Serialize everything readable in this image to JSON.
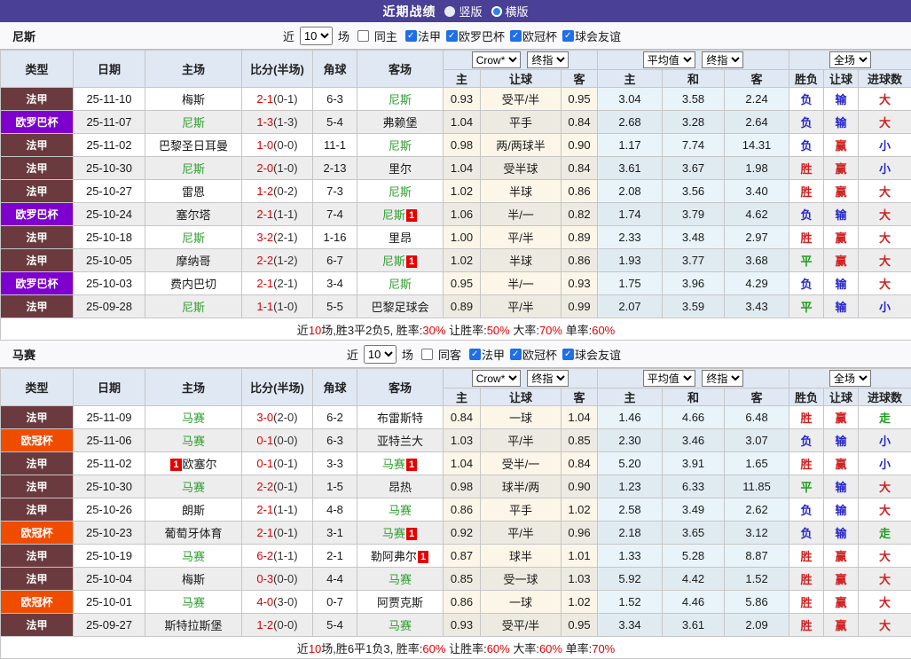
{
  "topbar": {
    "title": "近期战绩",
    "radios": [
      {
        "label": "竖版",
        "selected": false
      },
      {
        "label": "横版",
        "selected": true
      }
    ]
  },
  "columns": {
    "main": [
      "类型",
      "日期",
      "主场",
      "比分(半场)",
      "角球",
      "客场"
    ],
    "sub": [
      "主",
      "让球",
      "客",
      "主",
      "和",
      "客",
      "胜负",
      "让球",
      "进球数"
    ]
  },
  "league_colors": {
    "法甲": "#6b3a3e",
    "欧罗巴杯": "#7e00cf",
    "欧冠杯": "#f04c00"
  },
  "result_colors": {
    "胜": "#d02020",
    "平": "#1f9b1f",
    "负": "#2626cc",
    "赢": "#d02020",
    "输": "#2626cc",
    "大": "#d02020",
    "小": "#2626cc",
    "走": "#1f9b1f"
  },
  "sections": [
    {
      "team": "尼斯",
      "filters": {
        "near": "近",
        "count": "10",
        "unit": "场",
        "same": {
          "label": "同主",
          "checked": false
        },
        "leagues": [
          {
            "label": "法甲",
            "checked": true
          },
          {
            "label": "欧罗巴杯",
            "checked": true
          },
          {
            "label": "欧冠杯",
            "checked": true
          },
          {
            "label": "球会友谊",
            "checked": true
          }
        ]
      },
      "selects": [
        "Crow*",
        "终指",
        "平均值",
        "终指",
        "全场"
      ],
      "rows": [
        {
          "league": "法甲",
          "date": "25-11-10",
          "home": {
            "name": "梅斯"
          },
          "score": {
            "ft": "2-1",
            "ht": "(0-1)"
          },
          "corners": "6-3",
          "away": {
            "name": "尼斯",
            "self": true
          },
          "odds": [
            "0.93",
            "受平/半",
            "0.95"
          ],
          "avg": [
            "3.04",
            "3.58",
            "2.24"
          ],
          "results": [
            "负",
            "输",
            "大"
          ]
        },
        {
          "league": "欧罗巴杯",
          "date": "25-11-07",
          "home": {
            "name": "尼斯",
            "self": true
          },
          "score": {
            "ft": "1-3",
            "ht": "(1-3)"
          },
          "corners": "5-4",
          "away": {
            "name": "弗赖堡"
          },
          "odds": [
            "1.04",
            "平手",
            "0.84"
          ],
          "avg": [
            "2.68",
            "3.28",
            "2.64"
          ],
          "results": [
            "负",
            "输",
            "大"
          ]
        },
        {
          "league": "法甲",
          "date": "25-11-02",
          "home": {
            "name": "巴黎圣日耳曼"
          },
          "score": {
            "ft": "1-0",
            "ht": "(0-0)"
          },
          "corners": "11-1",
          "away": {
            "name": "尼斯",
            "self": true
          },
          "odds": [
            "0.98",
            "两/两球半",
            "0.90"
          ],
          "avg": [
            "1.17",
            "7.74",
            "14.31"
          ],
          "results": [
            "负",
            "赢",
            "小"
          ]
        },
        {
          "league": "法甲",
          "date": "25-10-30",
          "home": {
            "name": "尼斯",
            "self": true
          },
          "score": {
            "ft": "2-0",
            "ht": "(1-0)"
          },
          "corners": "2-13",
          "away": {
            "name": "里尔"
          },
          "odds": [
            "1.04",
            "受半球",
            "0.84"
          ],
          "avg": [
            "3.61",
            "3.67",
            "1.98"
          ],
          "results": [
            "胜",
            "赢",
            "小"
          ]
        },
        {
          "league": "法甲",
          "date": "25-10-27",
          "home": {
            "name": "雷恩"
          },
          "score": {
            "ft": "1-2",
            "ht": "(0-2)"
          },
          "corners": "7-3",
          "away": {
            "name": "尼斯",
            "self": true
          },
          "odds": [
            "1.02",
            "半球",
            "0.86"
          ],
          "avg": [
            "2.08",
            "3.56",
            "3.40"
          ],
          "results": [
            "胜",
            "赢",
            "大"
          ]
        },
        {
          "league": "欧罗巴杯",
          "date": "25-10-24",
          "home": {
            "name": "塞尔塔"
          },
          "score": {
            "ft": "2-1",
            "ht": "(1-1)"
          },
          "corners": "7-4",
          "away": {
            "name": "尼斯",
            "self": true,
            "badge": "1"
          },
          "odds": [
            "1.06",
            "半/一",
            "0.82"
          ],
          "avg": [
            "1.74",
            "3.79",
            "4.62"
          ],
          "results": [
            "负",
            "输",
            "大"
          ]
        },
        {
          "league": "法甲",
          "date": "25-10-18",
          "home": {
            "name": "尼斯",
            "self": true
          },
          "score": {
            "ft": "3-2",
            "ht": "(2-1)"
          },
          "corners": "1-16",
          "away": {
            "name": "里昂"
          },
          "odds": [
            "1.00",
            "平/半",
            "0.89"
          ],
          "avg": [
            "2.33",
            "3.48",
            "2.97"
          ],
          "results": [
            "胜",
            "赢",
            "大"
          ]
        },
        {
          "league": "法甲",
          "date": "25-10-05",
          "home": {
            "name": "摩纳哥"
          },
          "score": {
            "ft": "2-2",
            "ht": "(1-2)"
          },
          "corners": "6-7",
          "away": {
            "name": "尼斯",
            "self": true,
            "badge": "1"
          },
          "odds": [
            "1.02",
            "半球",
            "0.86"
          ],
          "avg": [
            "1.93",
            "3.77",
            "3.68"
          ],
          "results": [
            "平",
            "赢",
            "大"
          ]
        },
        {
          "league": "欧罗巴杯",
          "date": "25-10-03",
          "home": {
            "name": "费内巴切"
          },
          "score": {
            "ft": "2-1",
            "ht": "(2-1)"
          },
          "corners": "3-4",
          "away": {
            "name": "尼斯",
            "self": true
          },
          "odds": [
            "0.95",
            "半/一",
            "0.93"
          ],
          "avg": [
            "1.75",
            "3.96",
            "4.29"
          ],
          "results": [
            "负",
            "输",
            "大"
          ]
        },
        {
          "league": "法甲",
          "date": "25-09-28",
          "home": {
            "name": "尼斯",
            "self": true
          },
          "score": {
            "ft": "1-1",
            "ht": "(1-0)"
          },
          "corners": "5-5",
          "away": {
            "name": "巴黎足球会"
          },
          "odds": [
            "0.89",
            "平/半",
            "0.99"
          ],
          "avg": [
            "2.07",
            "3.59",
            "3.43"
          ],
          "results": [
            "平",
            "输",
            "小"
          ]
        }
      ],
      "summary": [
        {
          "text": "近"
        },
        {
          "text": "10",
          "red": true
        },
        {
          "text": "场,胜3平2负5, 胜率:"
        },
        {
          "text": "30%",
          "red": true
        },
        {
          "text": " 让胜率:"
        },
        {
          "text": "50%",
          "red": true
        },
        {
          "text": " 大率:"
        },
        {
          "text": "70%",
          "red": true
        },
        {
          "text": " 单率:"
        },
        {
          "text": "60%",
          "red": true
        }
      ]
    },
    {
      "team": "马赛",
      "filters": {
        "near": "近",
        "count": "10",
        "unit": "场",
        "same": {
          "label": "同客",
          "checked": false
        },
        "leagues": [
          {
            "label": "法甲",
            "checked": true
          },
          {
            "label": "欧冠杯",
            "checked": true
          },
          {
            "label": "球会友谊",
            "checked": true
          }
        ]
      },
      "selects": [
        "Crow*",
        "终指",
        "平均值",
        "终指",
        "全场"
      ],
      "rows": [
        {
          "league": "法甲",
          "date": "25-11-09",
          "home": {
            "name": "马赛",
            "self": true
          },
          "score": {
            "ft": "3-0",
            "ht": "(2-0)"
          },
          "corners": "6-2",
          "away": {
            "name": "布雷斯特"
          },
          "odds": [
            "0.84",
            "一球",
            "1.04"
          ],
          "avg": [
            "1.46",
            "4.66",
            "6.48"
          ],
          "results": [
            "胜",
            "赢",
            "走"
          ]
        },
        {
          "league": "欧冠杯",
          "date": "25-11-06",
          "home": {
            "name": "马赛",
            "self": true
          },
          "score": {
            "ft": "0-1",
            "ht": "(0-0)"
          },
          "corners": "6-3",
          "away": {
            "name": "亚特兰大"
          },
          "odds": [
            "1.03",
            "平/半",
            "0.85"
          ],
          "avg": [
            "2.30",
            "3.46",
            "3.07"
          ],
          "results": [
            "负",
            "输",
            "小"
          ]
        },
        {
          "league": "法甲",
          "date": "25-11-02",
          "home": {
            "name": "欧塞尔",
            "badge": "1",
            "badge_pos": "before"
          },
          "score": {
            "ft": "0-1",
            "ht": "(0-1)"
          },
          "corners": "3-3",
          "away": {
            "name": "马赛",
            "self": true,
            "badge": "1"
          },
          "odds": [
            "1.04",
            "受半/一",
            "0.84"
          ],
          "avg": [
            "5.20",
            "3.91",
            "1.65"
          ],
          "results": [
            "胜",
            "赢",
            "小"
          ]
        },
        {
          "league": "法甲",
          "date": "25-10-30",
          "home": {
            "name": "马赛",
            "self": true
          },
          "score": {
            "ft": "2-2",
            "ht": "(0-1)"
          },
          "corners": "1-5",
          "away": {
            "name": "昂热"
          },
          "odds": [
            "0.98",
            "球半/两",
            "0.90"
          ],
          "avg": [
            "1.23",
            "6.33",
            "11.85"
          ],
          "results": [
            "平",
            "输",
            "大"
          ]
        },
        {
          "league": "法甲",
          "date": "25-10-26",
          "home": {
            "name": "朗斯"
          },
          "score": {
            "ft": "2-1",
            "ht": "(1-1)"
          },
          "corners": "4-8",
          "away": {
            "name": "马赛",
            "self": true
          },
          "odds": [
            "0.86",
            "平手",
            "1.02"
          ],
          "avg": [
            "2.58",
            "3.49",
            "2.62"
          ],
          "results": [
            "负",
            "输",
            "大"
          ]
        },
        {
          "league": "欧冠杯",
          "date": "25-10-23",
          "home": {
            "name": "葡萄牙体育"
          },
          "score": {
            "ft": "2-1",
            "ht": "(0-1)"
          },
          "corners": "3-1",
          "away": {
            "name": "马赛",
            "self": true,
            "badge": "1"
          },
          "odds": [
            "0.92",
            "平/半",
            "0.96"
          ],
          "avg": [
            "2.18",
            "3.65",
            "3.12"
          ],
          "results": [
            "负",
            "输",
            "走"
          ]
        },
        {
          "league": "法甲",
          "date": "25-10-19",
          "home": {
            "name": "马赛",
            "self": true
          },
          "score": {
            "ft": "6-2",
            "ht": "(1-1)"
          },
          "corners": "2-1",
          "away": {
            "name": "勒阿弗尔",
            "badge": "1"
          },
          "odds": [
            "0.87",
            "球半",
            "1.01"
          ],
          "avg": [
            "1.33",
            "5.28",
            "8.87"
          ],
          "results": [
            "胜",
            "赢",
            "大"
          ]
        },
        {
          "league": "法甲",
          "date": "25-10-04",
          "home": {
            "name": "梅斯"
          },
          "score": {
            "ft": "0-3",
            "ht": "(0-0)"
          },
          "corners": "4-4",
          "away": {
            "name": "马赛",
            "self": true
          },
          "odds": [
            "0.85",
            "受一球",
            "1.03"
          ],
          "avg": [
            "5.92",
            "4.42",
            "1.52"
          ],
          "results": [
            "胜",
            "赢",
            "大"
          ]
        },
        {
          "league": "欧冠杯",
          "date": "25-10-01",
          "home": {
            "name": "马赛",
            "self": true
          },
          "score": {
            "ft": "4-0",
            "ht": "(3-0)"
          },
          "corners": "0-7",
          "away": {
            "name": "阿贾克斯"
          },
          "odds": [
            "0.86",
            "一球",
            "1.02"
          ],
          "avg": [
            "1.52",
            "4.46",
            "5.86"
          ],
          "results": [
            "胜",
            "赢",
            "大"
          ]
        },
        {
          "league": "法甲",
          "date": "25-09-27",
          "home": {
            "name": "斯特拉斯堡"
          },
          "score": {
            "ft": "1-2",
            "ht": "(0-0)"
          },
          "corners": "5-4",
          "away": {
            "name": "马赛",
            "self": true
          },
          "odds": [
            "0.93",
            "受平/半",
            "0.95"
          ],
          "avg": [
            "3.34",
            "3.61",
            "2.09"
          ],
          "results": [
            "胜",
            "赢",
            "大"
          ]
        }
      ],
      "summary": [
        {
          "text": "近"
        },
        {
          "text": "10",
          "red": true
        },
        {
          "text": "场,胜6平1负3, 胜率:"
        },
        {
          "text": "60%",
          "red": true
        },
        {
          "text": " 让胜率:"
        },
        {
          "text": "60%",
          "red": true
        },
        {
          "text": " 大率:"
        },
        {
          "text": "60%",
          "red": true
        },
        {
          "text": " 单率:"
        },
        {
          "text": "70%",
          "red": true
        }
      ]
    }
  ]
}
